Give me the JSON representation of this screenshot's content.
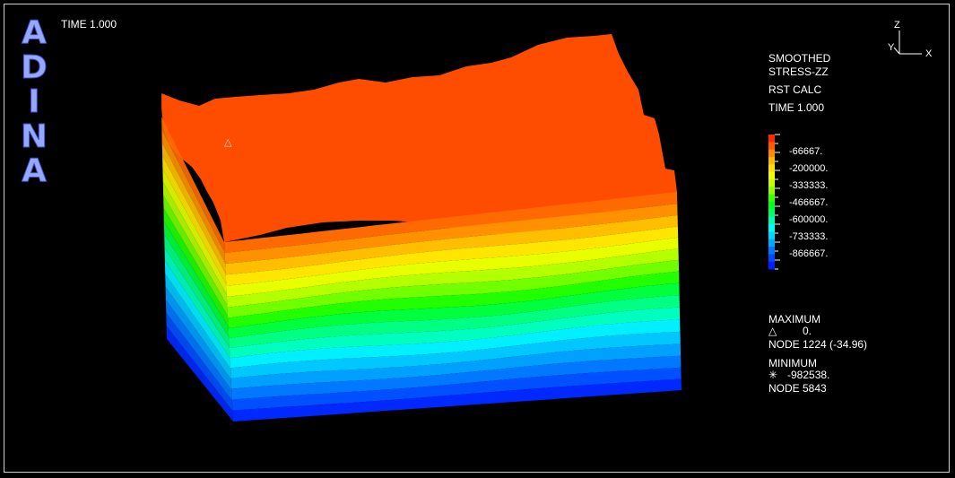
{
  "brand": {
    "letters": [
      "A",
      "D",
      "I",
      "N",
      "A"
    ]
  },
  "time_label": "TIME 1.000",
  "axes": {
    "z": "Z",
    "y": "Y",
    "x": "X"
  },
  "info": {
    "line1": "SMOOTHED",
    "line2": "STRESS-ZZ",
    "line3": "RST CALC",
    "line4": "TIME 1.000"
  },
  "legend": {
    "labels": [
      "-66667.",
      "-200000.",
      "-333333.",
      "-466667.",
      "-600000.",
      "-733333.",
      "-866667."
    ],
    "colors": [
      "#ff2a00",
      "#ff5a00",
      "#ff8a00",
      "#ffb800",
      "#ffe000",
      "#f2ff00",
      "#c8ff00",
      "#8cff00",
      "#3cff00",
      "#00ff22",
      "#00ff70",
      "#00ffb0",
      "#00fff0",
      "#00d8ff",
      "#00aaff",
      "#0078ff",
      "#0048ff",
      "#0020ff"
    ]
  },
  "extremes": {
    "max_title": "MAXIMUM",
    "max_symbol": "△",
    "max_value": "0.",
    "max_node": "NODE 1224 (-34.96)",
    "min_title": "MINIMUM",
    "min_symbol": "✳",
    "min_value": "-982538.",
    "min_node": "NODE 5843"
  },
  "model": {
    "top_color": "#ff4d00",
    "band_colors": [
      "#ff6a00",
      "#ff9000",
      "#ffbe00",
      "#ffe600",
      "#e8ff00",
      "#b4ff00",
      "#72ff00",
      "#22ff00",
      "#00ff3c",
      "#00ff82",
      "#00ffbe",
      "#00f0ff",
      "#00c8ff",
      "#00a0ff",
      "#0078ff",
      "#0050ff",
      "#0028ff"
    ]
  }
}
